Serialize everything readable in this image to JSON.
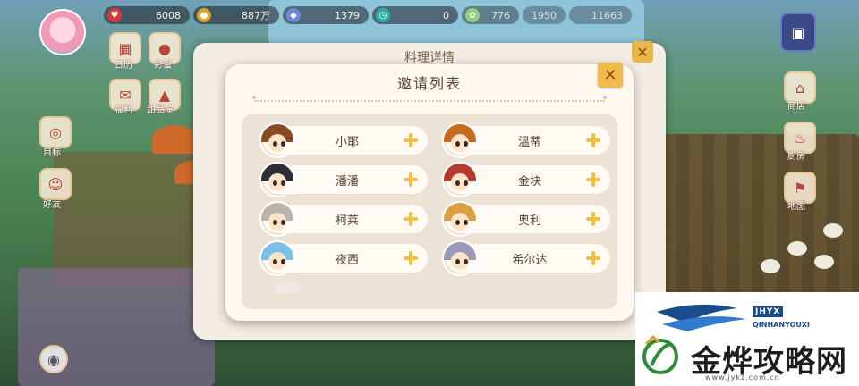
{
  "resources": [
    {
      "icon": "heart-icon",
      "value": "6008",
      "color": "#d83a3a"
    },
    {
      "icon": "coin-icon",
      "value": "887万",
      "color": "#e0a030"
    },
    {
      "icon": "gem-icon",
      "value": "1379",
      "color": "#6a8ad8"
    },
    {
      "icon": "clock-icon",
      "value": "0",
      "color": "#2bb0a8"
    },
    {
      "icon": "pet-icon",
      "value": "776",
      "color": "#9bd05a"
    },
    {
      "icon": "farm-icon",
      "value": "1950",
      "color": "#8ec4d8"
    },
    {
      "icon": "house-icon",
      "value": "11663",
      "color": "#8ec4d8"
    }
  ],
  "side_left": [
    {
      "label": "日历"
    },
    {
      "label": "彩蛋"
    },
    {
      "label": "福利"
    },
    {
      "label": "甜品屋"
    },
    {
      "label": "目标"
    },
    {
      "label": "好友"
    }
  ],
  "side_right": [
    {
      "label": "商店"
    },
    {
      "label": "厨房"
    },
    {
      "label": "地图"
    }
  ],
  "back_panel": {
    "title": "料理详情"
  },
  "dialog": {
    "title": "邀请列表",
    "close_label": "✕",
    "friends": [
      {
        "name": "小耶",
        "hair": "#8a4a22"
      },
      {
        "name": "温蒂",
        "hair": "#c76a1e"
      },
      {
        "name": "潘潘",
        "hair": "#2d2d38"
      },
      {
        "name": "金块",
        "hair": "#b83a2e"
      },
      {
        "name": "柯莱",
        "hair": "#b8b4b0"
      },
      {
        "name": "奥利",
        "hair": "#d8a03e"
      },
      {
        "name": "夜西",
        "hair": "#7ac0e8"
      },
      {
        "name": "希尔达",
        "hair": "#9a9ab8"
      }
    ]
  },
  "watermark": {
    "tag": "JHYX",
    "sub": "QINHANYOUXI",
    "name": "金烨攻略网",
    "url": "www.jykz.com.cn"
  }
}
